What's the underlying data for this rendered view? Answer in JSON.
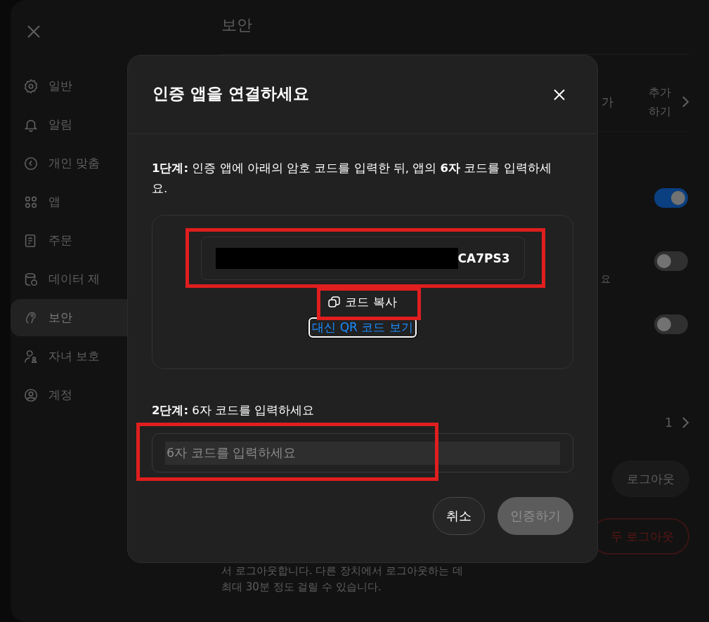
{
  "sidebar": {
    "items": [
      {
        "label": "일반",
        "selected": false
      },
      {
        "label": "알림",
        "selected": false
      },
      {
        "label": "개인 맞춤",
        "selected": false
      },
      {
        "label": "앱",
        "selected": false
      },
      {
        "label": "주문",
        "selected": false
      },
      {
        "label": "데이터 제",
        "selected": false
      },
      {
        "label": "보안",
        "selected": true
      },
      {
        "label": "자녀 보호",
        "selected": false
      },
      {
        "label": "계정",
        "selected": false
      }
    ]
  },
  "page_title": "보안",
  "background": {
    "partial_1": "가",
    "add_link": "추가하기",
    "toggles": [
      {
        "on": true
      },
      {
        "on": false
      },
      {
        "on": false
      }
    ],
    "partial_2": "요",
    "count": "1",
    "logout_button": "로그아웃",
    "logout_all_button": "두 로그아웃",
    "note": "서 로그아웃합니다. 다른 장치에서 로그아웃하는 데\n최대 30분 정도 걸릴 수 있습니다."
  },
  "dialog": {
    "title": "인증 앱을 연결하세요",
    "step_1": "**1단계:** 인증 앱에 아래의 암호 코드를 입력한 뒤, 앱의 **6자** 코드를 입력하세요.",
    "secret_code": {
      "value": "CA7PS3",
      "redacted": true,
      "highlighted": true
    },
    "copy_button": {
      "label": "코드 복사",
      "highlighted": true
    },
    "qr_link": {
      "label": "대신 QR 코드 보기",
      "focused": true
    },
    "step_2": "**2단계:** 6자 코드를 입력하세요",
    "code_input": {
      "placeholder": "6자 코드를 입력하세요",
      "highlighted": true
    },
    "buttons": [
      {
        "label": "취소",
        "disabled": false,
        "kind": "secondary"
      },
      {
        "label": "인증하기",
        "disabled": true,
        "kind": "primary"
      }
    ]
  }
}
